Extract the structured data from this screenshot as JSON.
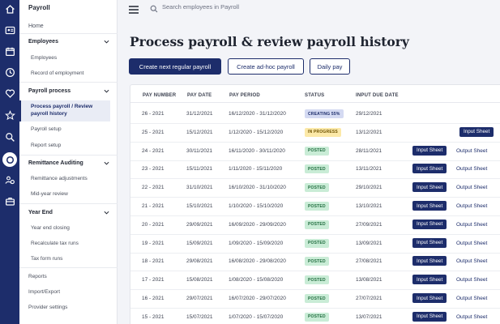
{
  "sidebar": {
    "title": "Payroll",
    "home": "Home",
    "employees": {
      "label": "Employees",
      "items": [
        "Employees",
        "Record of employment"
      ]
    },
    "payroll_process": {
      "label": "Payroll process",
      "active_item": "Process payroll / Review payroll history",
      "items": [
        "Payroll setup",
        "Report setup"
      ]
    },
    "remittance": {
      "label": "Remittance Auditing",
      "items": [
        "Remittance adjustments",
        "Mid-year review"
      ]
    },
    "year_end": {
      "label": "Year End",
      "items": [
        "Year end closing",
        "Recalculate tax runs",
        "Tax form runs"
      ]
    },
    "bottom_links": [
      "Reports",
      "Import/Export",
      "Provider settings"
    ]
  },
  "search": {
    "placeholder": "Search employees in Payroll"
  },
  "page": {
    "title": "Process payroll & review payroll history",
    "buttons": {
      "next_regular": "Create next regular payroll",
      "ad_hoc": "Create ad-hoc payroll",
      "daily": "Daily pay"
    }
  },
  "table": {
    "headers": [
      "PAY NUMBER",
      "PAY DATE",
      "PAY PERIOD",
      "STATUS",
      "INPUT DUE DATE"
    ],
    "input_sheet_label": "Input Sheet",
    "output_sheet_label": "Output Sheet",
    "rows": [
      {
        "pay_number": "26 - 2021",
        "pay_date": "31/12/2021",
        "pay_period": "16/12/2020 - 31/12/2020",
        "status": "CREATING 55%",
        "status_type": "creating",
        "input_due": "29/12/2021",
        "input_sheet": false,
        "output_sheet": false
      },
      {
        "pay_number": "25 - 2021",
        "pay_date": "15/12/2021",
        "pay_period": "1/12/2020 - 15/12/2020",
        "status": "IN PROGRESS",
        "status_type": "progress",
        "input_due": "13/12/2021",
        "input_sheet": true,
        "output_sheet": false
      },
      {
        "pay_number": "24 - 2021",
        "pay_date": "30/11/2021",
        "pay_period": "16/11/2020 - 30/11/2020",
        "status": "POSTED",
        "status_type": "posted",
        "input_due": "28/11/2021",
        "input_sheet": true,
        "output_sheet": true
      },
      {
        "pay_number": "23 - 2021",
        "pay_date": "15/11/2021",
        "pay_period": "1/11/2020 - 15/11/2020",
        "status": "POSTED",
        "status_type": "posted",
        "input_due": "13/11/2021",
        "input_sheet": true,
        "output_sheet": true
      },
      {
        "pay_number": "22 - 2021",
        "pay_date": "31/10/2021",
        "pay_period": "16/10/2020 - 31/10/2020",
        "status": "POSTED",
        "status_type": "posted",
        "input_due": "29/10/2021",
        "input_sheet": true,
        "output_sheet": true
      },
      {
        "pay_number": "21 - 2021",
        "pay_date": "15/10/2021",
        "pay_period": "1/10/2020 - 15/10/2020",
        "status": "POSTED",
        "status_type": "posted",
        "input_due": "13/10/2021",
        "input_sheet": true,
        "output_sheet": true
      },
      {
        "pay_number": "20 - 2021",
        "pay_date": "29/09/2021",
        "pay_period": "16/09/2020 - 29/09/2020",
        "status": "POSTED",
        "status_type": "posted",
        "input_due": "27/09/2021",
        "input_sheet": true,
        "output_sheet": true
      },
      {
        "pay_number": "19 - 2021",
        "pay_date": "15/09/2021",
        "pay_period": "1/09/2020 - 15/09/2020",
        "status": "POSTED",
        "status_type": "posted",
        "input_due": "13/09/2021",
        "input_sheet": true,
        "output_sheet": true
      },
      {
        "pay_number": "18 - 2021",
        "pay_date": "29/08/2021",
        "pay_period": "16/08/2020 - 29/08/2020",
        "status": "POSTED",
        "status_type": "posted",
        "input_due": "27/08/2021",
        "input_sheet": true,
        "output_sheet": true
      },
      {
        "pay_number": "17 - 2021",
        "pay_date": "15/08/2021",
        "pay_period": "1/08/2020 - 15/08/2020",
        "status": "POSTED",
        "status_type": "posted",
        "input_due": "13/08/2021",
        "input_sheet": true,
        "output_sheet": true
      },
      {
        "pay_number": "16 - 2021",
        "pay_date": "29/07/2021",
        "pay_period": "16/07/2020 - 29/07/2020",
        "status": "POSTED",
        "status_type": "posted",
        "input_due": "27/07/2021",
        "input_sheet": true,
        "output_sheet": true
      },
      {
        "pay_number": "15 - 2021",
        "pay_date": "15/07/2021",
        "pay_period": "1/07/2020 - 15/07/2020",
        "status": "POSTED",
        "status_type": "posted",
        "input_due": "13/07/2021",
        "input_sheet": true,
        "output_sheet": true
      }
    ]
  },
  "rail_icons": [
    "home-icon",
    "person-card-icon",
    "calendar-icon",
    "clock-icon",
    "heart-icon",
    "star-icon",
    "search-people-icon",
    "payroll-icon",
    "people-settings-icon",
    "briefcase-icon"
  ],
  "colors": {
    "brand": "#1d2d6b",
    "posted_bg": "#c9ecd6",
    "in_progress_bg": "#fce9a8",
    "creating_bg": "#d4daf2",
    "background": "#f3f4f8"
  }
}
